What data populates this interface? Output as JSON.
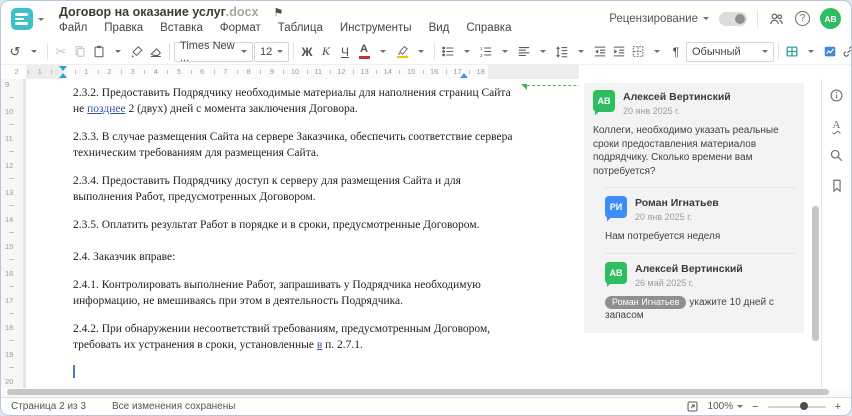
{
  "colors": {
    "accent_teal": "#3ec0c6",
    "avatar_green": "#2ebd60",
    "avatar_blue": "#3e8df7",
    "anchor_green": "#4caf50",
    "tracked_change_blue": "#3457a0",
    "highlight_yellow": "#f2c500",
    "font_color_red": "#bf3434"
  },
  "header": {
    "title": "Договор на оказание услуг",
    "title_ext": ".docx",
    "menus": [
      "Файл",
      "Правка",
      "Вставка",
      "Формат",
      "Таблица",
      "Инструменты",
      "Вид",
      "Справка"
    ],
    "review_label": "Рецензирование",
    "user_initials": "АВ"
  },
  "icons": {
    "undo": "↺",
    "cut": "✂",
    "flag": "⚑",
    "pilcrow": "¶",
    "more": "...",
    "help": "?",
    "spellcheck_letter": "А"
  },
  "toolbar": {
    "font_name": "Times New ...",
    "font_size": "12",
    "bold": "Ж",
    "italic": "К",
    "underline": "Ч",
    "font_color_letter": "А",
    "style_name": "Обычный"
  },
  "ruler": {
    "h_start": -2,
    "h_end": 18,
    "v_start": 9,
    "v_end": 20
  },
  "document": {
    "paragraphs": [
      {
        "segments": [
          {
            "text": "2.3.2. Предоставить Подрядчику необходимые материалы для наполнения страниц Сайта не "
          },
          {
            "text": "позднее",
            "tracked": true
          },
          {
            "text": " 2 (двух) дней с момента заключения Договора."
          }
        ]
      },
      {
        "segments": [
          {
            "text": "2.3.3. В случае размещения Сайта на сервере Заказчика, обеспечить соответствие сервера техническим требованиям для размещения Сайта."
          }
        ]
      },
      {
        "segments": [
          {
            "text": "2.3.4. Предоставить Подрядчику доступ к серверу для размещения Сайта и для выполнения Работ, предусмотренных Договором."
          }
        ]
      },
      {
        "segments": [
          {
            "text": "2.3.5. Оплатить результат Работ в порядке и в сроки, предусмотренные Договором."
          }
        ]
      },
      {
        "gap_before": true,
        "segments": [
          {
            "text": "2.4. Заказчик вправе:"
          }
        ]
      },
      {
        "segments": [
          {
            "text": "2.4.1. Контролировать выполнение Работ, запрашивать у Подрядчика необходимую информацию, не вмешиваясь при этом в деятельность Подрядчика."
          }
        ]
      },
      {
        "segments": [
          {
            "text": "2.4.2. При обнаружении несоответствий требованиям, предусмотренным Договором, требовать их устранения в сроки, установленные "
          },
          {
            "text": "в",
            "tracked": true
          },
          {
            "text": " п. 2.7.1."
          }
        ]
      }
    ]
  },
  "comments": {
    "thread": {
      "comment": {
        "initials": "АВ",
        "name": "Алексей Вертинский",
        "date": "20 янв 2025 г.",
        "text": "Коллеги, необходимо указать реальные сроки предоставления материалов подрядчику. Сколько времени вам потребуется?",
        "avatar_color": "#2ebd60"
      },
      "replies": [
        {
          "initials": "РИ",
          "name": "Роман Игнатьев",
          "date": "20 янв 2025 г.",
          "text": "Нам потребуется неделя",
          "avatar_color": "#3e8df7"
        },
        {
          "initials": "АВ",
          "name": "Алексей Вертинский",
          "date": "26 май 2025 г.",
          "mention": "Роман Игнатьев",
          "text": "укажите 10 дней с запасом",
          "avatar_color": "#2ebd60"
        }
      ]
    }
  },
  "statusbar": {
    "page_label": "Страница 2 из 3",
    "saved_label": "Все изменения сохранены",
    "zoom_value": "100%",
    "zoom_minus": "−",
    "zoom_plus": "+"
  }
}
